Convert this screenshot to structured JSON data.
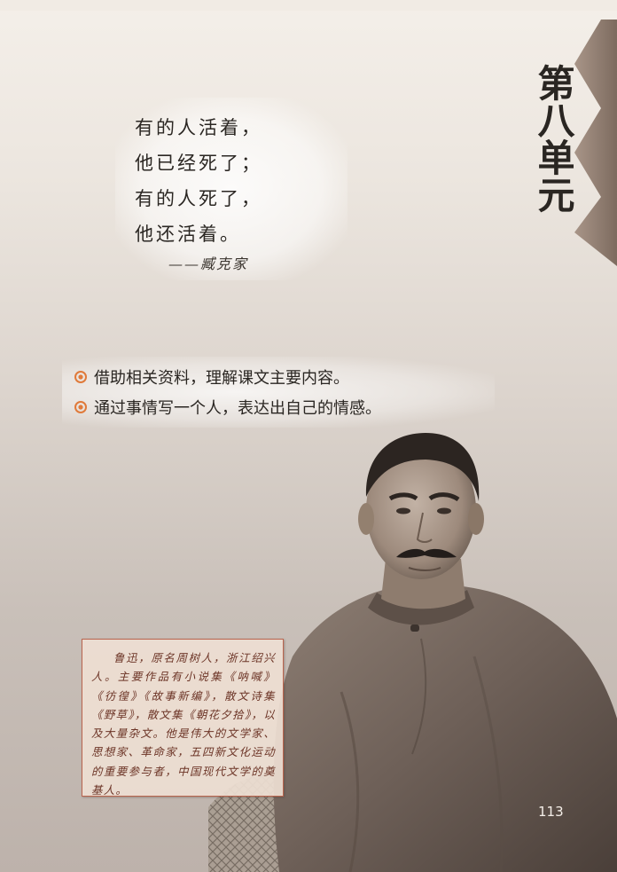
{
  "unit": {
    "title": "第八单元"
  },
  "poem": {
    "lines": [
      "有的人活着，",
      "他已经死了；",
      "有的人死了，",
      "他还活着。"
    ],
    "author": "——臧克家"
  },
  "goals": [
    "借助相关资料，理解课文主要内容。",
    "通过事情写一个人，表达出自己的情感。"
  ],
  "bio": {
    "text": "鲁迅，原名周树人，浙江绍兴人。主要作品有小说集《呐喊》《彷徨》《故事新编》，散文诗集《野草》，散文集《朝花夕拾》，以及大量杂文。他是伟大的文学家、思想家、革命家，五四新文化运动的重要参与者，中国现代文学的奠基人。"
  },
  "page": {
    "number": "113"
  },
  "colors": {
    "accent": "#b9654f",
    "bullet": "#e07a3a",
    "zigzag": "#8f7d70"
  }
}
